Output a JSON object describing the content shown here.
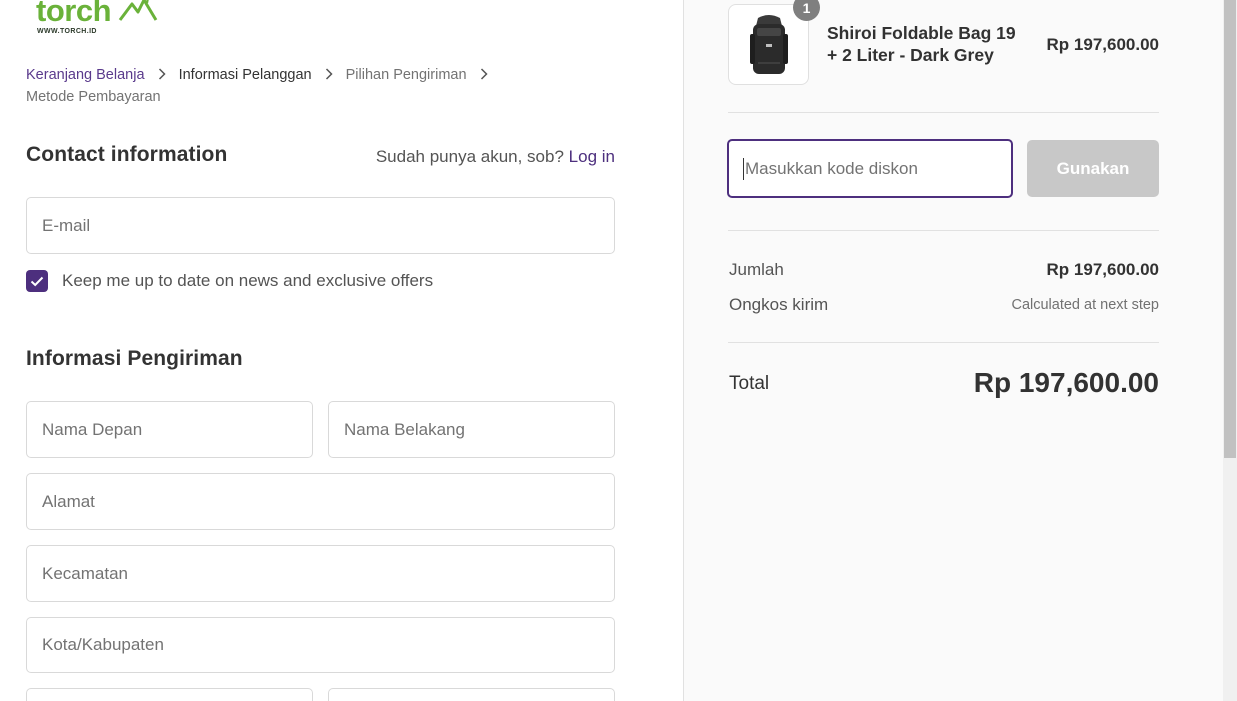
{
  "brand": {
    "name": "torch",
    "url_text": "WWW.TORCH.ID",
    "color": "#6ab23a"
  },
  "breadcrumb": [
    {
      "label": "Keranjang Belanja",
      "state": "link"
    },
    {
      "label": "Informasi Pelanggan",
      "state": "current"
    },
    {
      "label": "Pilihan Pengiriman",
      "state": "upcoming"
    },
    {
      "label": "Metode Pembayaran",
      "state": "upcoming"
    }
  ],
  "contact": {
    "title": "Contact information",
    "login_prompt": "Sudah punya akun, sob?",
    "login_link": "Log in",
    "email_placeholder": "E-mail",
    "newsletter_label": "Keep me up to date on news and exclusive offers",
    "newsletter_checked": true
  },
  "shipping": {
    "title": "Informasi Pengiriman",
    "first_name_placeholder": "Nama Depan",
    "last_name_placeholder": "Nama Belakang",
    "address_placeholder": "Alamat",
    "district_placeholder": "Kecamatan",
    "city_placeholder": "Kota/Kabupaten"
  },
  "order": {
    "item": {
      "name": "Shiroi Foldable Bag 19 + 2 Liter - Dark Grey",
      "price": "Rp 197,600.00",
      "quantity": "1"
    },
    "discount_placeholder": "Masukkan kode diskon",
    "apply_label": "Gunakan",
    "subtotal_label": "Jumlah",
    "subtotal_value": "Rp 197,600.00",
    "shipping_label": "Ongkos kirim",
    "shipping_value": "Calculated at next step",
    "total_label": "Total",
    "total_value": "Rp 197,600.00"
  },
  "colors": {
    "accent": "#4d2f7e",
    "button_disabled": "#c8c8c8",
    "sidebar_bg": "#fafafa"
  }
}
